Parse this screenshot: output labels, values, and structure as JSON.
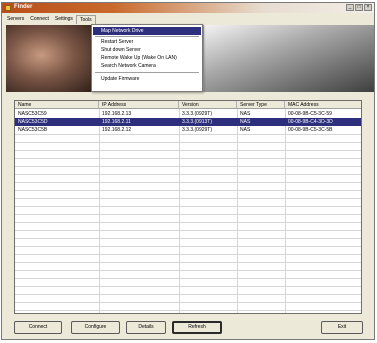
{
  "window": {
    "title": "Finder",
    "minimize": "_",
    "maximize": "□",
    "close": "×"
  },
  "menu": [
    "Servers",
    "Connect",
    "Settings",
    "Tools"
  ],
  "tools_menu": [
    "Map Network Drive",
    "Restart Server",
    "Shut down Server",
    "Remote Wake Up (Wake On LAN)",
    "Search Network Camera",
    "Update Firmware"
  ],
  "table": {
    "columns": [
      "Name",
      "IP Address",
      "Version",
      "Server Type",
      "MAC Address"
    ],
    "rows": [
      [
        "NASC53C59",
        "192.168.2.13",
        "3.3.3.(0929T)",
        "NAS",
        "00-08-9B-C5-3C-59"
      ],
      [
        "NASC53C5D",
        "192.168.2.11",
        "3.3.3.(0913T)",
        "NAS",
        "00-08-9B-C4-3D-3D"
      ],
      [
        "NASC53C5B",
        "192.168.2.12",
        "3.3.3.(0929T)",
        "NAS",
        "00-08-9B-C5-3C-5B"
      ]
    ],
    "selected_row": 1
  },
  "buttons": {
    "connect": "Connect",
    "configure": "Configure",
    "details": "Details",
    "refresh": "Refresh",
    "exit": "Exit"
  },
  "colors": {
    "selection": "#2d2f7d",
    "titlebar": "#b84e1a",
    "window_bg": "#ece9d8"
  }
}
